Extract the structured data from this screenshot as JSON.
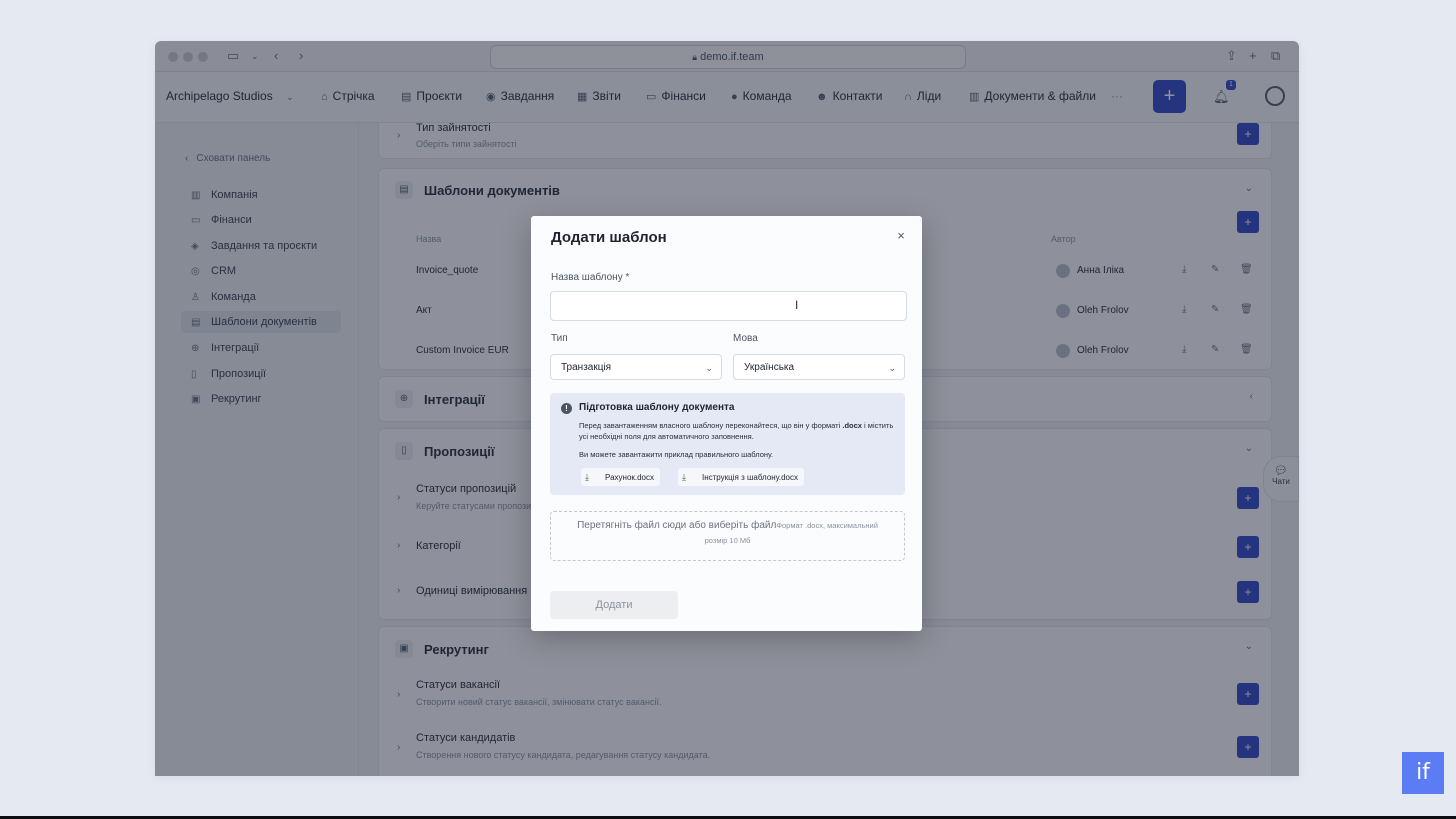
{
  "browser": {
    "url": "demo.if.team"
  },
  "topnav": {
    "org": "Archipelago Studios",
    "items": [
      {
        "label": "Стрічка",
        "icon": "home-icon"
      },
      {
        "label": "Проєкти",
        "icon": "folder-icon"
      },
      {
        "label": "Завдання",
        "icon": "check-circle-icon"
      },
      {
        "label": "Звіти",
        "icon": "report-icon"
      },
      {
        "label": "Фінанси",
        "icon": "wallet-icon"
      },
      {
        "label": "Команда",
        "icon": "user-icon"
      },
      {
        "label": "Контакти",
        "icon": "contacts-icon"
      },
      {
        "label": "Ліди",
        "icon": "magnet-icon"
      },
      {
        "label": "Документи & файли",
        "icon": "files-icon"
      }
    ],
    "more": "···",
    "plus": "+",
    "notification_count": "1"
  },
  "sidebar": {
    "hide_label": "Сховати панель",
    "items": [
      {
        "label": "Компанія",
        "icon": "building-icon"
      },
      {
        "label": "Фінанси",
        "icon": "card-icon"
      },
      {
        "label": "Завдання та проєкти",
        "icon": "layers-icon"
      },
      {
        "label": "CRM",
        "icon": "target-icon"
      },
      {
        "label": "Команда",
        "icon": "users-icon"
      },
      {
        "label": "Шаблони документів",
        "icon": "template-icon"
      },
      {
        "label": "Інтеграції",
        "icon": "globe-icon"
      },
      {
        "label": "Пропозиції",
        "icon": "document-icon"
      },
      {
        "label": "Рекрутинг",
        "icon": "briefcase-icon"
      }
    ]
  },
  "content": {
    "employment_type": {
      "title": "Тип зайнятості",
      "subtitle": "Оберіть типи зайнятості"
    },
    "templates": {
      "title": "Шаблони документів",
      "col_name": "Назва",
      "col_author": "Автор",
      "rows": [
        {
          "name": "Invoice_quote",
          "author": "Анна Іліка"
        },
        {
          "name": "Акт",
          "author": "Oleh Frolov"
        },
        {
          "name": "Custom Invoice EUR",
          "author": "Oleh Frolov"
        }
      ]
    },
    "integrations": {
      "title": "Інтеграції"
    },
    "proposals": {
      "title": "Пропозиції",
      "rows": [
        {
          "title": "Статуси пропозицій",
          "subtitle": "Керуйте статусами пропозицій"
        },
        {
          "title": "Категорії",
          "subtitle": ""
        },
        {
          "title": "Одиниці вимірювання",
          "subtitle": ""
        }
      ]
    },
    "recruiting": {
      "title": "Рекрутинг",
      "rows": [
        {
          "title": "Статуси вакансії",
          "subtitle": "Створити новий статус вакансії, змінювати статус вакансії."
        },
        {
          "title": "Статуси кандидатів",
          "subtitle": "Створення нового статусу кандидата, редагування статусу кандидата."
        }
      ]
    }
  },
  "modal": {
    "title": "Додати шаблон",
    "name_label": "Назва шаблону *",
    "name_value": "",
    "type_label": "Тип",
    "type_value": "Транзакція",
    "lang_label": "Мова",
    "lang_value": "Українська",
    "info": {
      "title": "Підготовка шаблону документа",
      "text1_a": "Перед завантаженням власного шаблону переконайтеся, що він у форматі ",
      "text1_b": ".docx",
      "text1_c": " і містить усі необхідні поля для автоматичного заповнення.",
      "text2": "Ви можете завантажити приклад правильного шаблону.",
      "btn1": "Рахунок.docx",
      "btn2": "Інструкція з шаблону.docx"
    },
    "dropzone_main": "Перетягніть файл сюди або виберіть файл",
    "dropzone_hint": "Формат .docx, максимальний",
    "dropzone_sub": "розмір 10 Мб",
    "submit": "Додати"
  },
  "chats": {
    "label": "Чати"
  },
  "brand": {
    "logo": "if"
  },
  "colors": {
    "accent": "#3349c8",
    "logo": "#5b7cf5"
  }
}
